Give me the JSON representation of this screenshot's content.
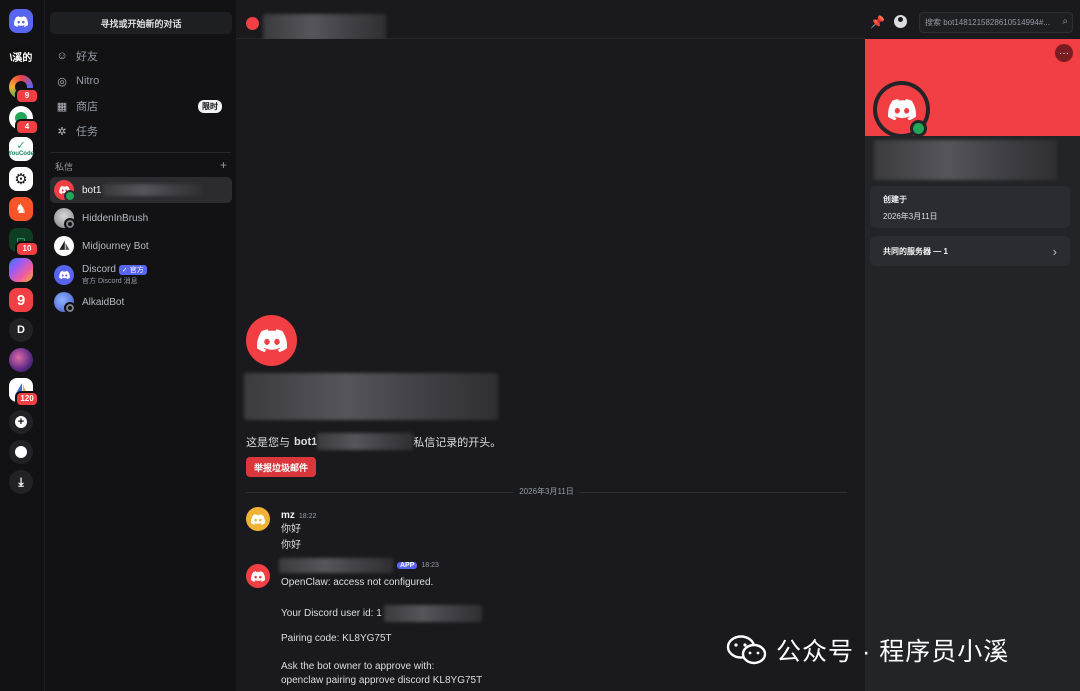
{
  "app": {
    "brand_color": "#5865f2",
    "accent_red": "#f23f43"
  },
  "rail": {
    "items": [
      {
        "name": "discord-home",
        "label": "",
        "badge": ""
      },
      {
        "name": "server-xiaoxi",
        "label": "\\溪的",
        "badge": ""
      },
      {
        "name": "server-ring",
        "label": "",
        "badge": "9"
      },
      {
        "name": "server-green",
        "label": "",
        "badge": "4"
      },
      {
        "name": "server-youcode",
        "label": "YouCode",
        "badge": ""
      },
      {
        "name": "server-gear",
        "label": "",
        "badge": ""
      },
      {
        "name": "server-brave",
        "label": "",
        "badge": ""
      },
      {
        "name": "server-terminal",
        "label": "",
        "badge": "10"
      },
      {
        "name": "server-copilot",
        "label": "",
        "badge": ""
      },
      {
        "name": "server-nine",
        "label": "9",
        "badge": ""
      },
      {
        "name": "server-d",
        "label": "D",
        "badge": ""
      },
      {
        "name": "server-sphere",
        "label": "",
        "badge": ""
      },
      {
        "name": "server-sail",
        "label": "",
        "badge": "120"
      }
    ]
  },
  "sidebar": {
    "find_label": "寻找或开始新的对话",
    "nav": [
      {
        "icon": "friends-icon",
        "label": "好友"
      },
      {
        "icon": "nitro-icon",
        "label": "Nitro"
      },
      {
        "icon": "shop-icon",
        "label": "商店",
        "tag": "限时"
      },
      {
        "icon": "quests-icon",
        "label": "任务"
      }
    ],
    "dm_title": "私信",
    "dm_add": "+",
    "dms": [
      {
        "name": "bot1",
        "status": "online"
      },
      {
        "name": "HiddenInBrush",
        "status": "offline"
      },
      {
        "name": "Midjourney Bot",
        "status": ""
      },
      {
        "name": "Discord",
        "tag": "官方",
        "sub": "官方 Discord 消息"
      },
      {
        "name": "AlkaidBot",
        "status": "offline"
      }
    ]
  },
  "header": {
    "search_placeholder": "搜索 bot1481215828610514994#..."
  },
  "chat": {
    "intro_prefix": "这是您与",
    "intro_name": "bot1",
    "intro_suffix": "私信记录的开头。",
    "report_label": "举报垃圾邮件",
    "date_divider": "2026年3月11日",
    "messages": [
      {
        "author": "mz",
        "time": "18:22",
        "lines": [
          "你好",
          "你好"
        ]
      },
      {
        "author": "",
        "tag": "APP",
        "time": "18:23",
        "lines": [
          "OpenClaw: access not configured.",
          "Your Discord user id: 1",
          "Pairing code: KL8YG75T",
          "Ask the bot owner to approve with:",
          "openclaw pairing approve discord KL8YG75T"
        ]
      }
    ]
  },
  "profile": {
    "created_label": "创建于",
    "created_value": "2026年3月11日",
    "mutual_label": "共同的服务器 — 1"
  },
  "watermark": {
    "text": "公众号 · 程序员小溪"
  }
}
